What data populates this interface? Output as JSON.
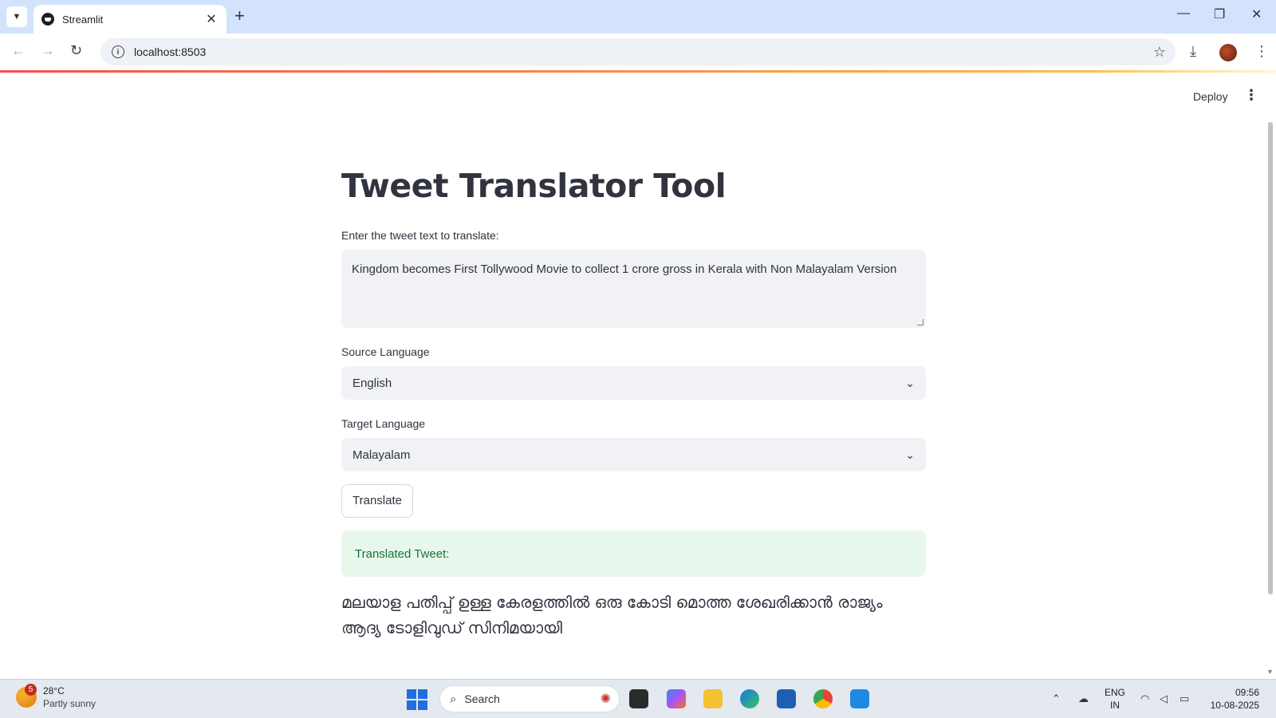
{
  "browser": {
    "tab_title": "Streamlit",
    "url": "localhost:8503"
  },
  "app": {
    "deploy_label": "Deploy",
    "title": "Tweet Translator Tool",
    "input_label": "Enter the tweet text to translate:",
    "input_value": "Kingdom becomes First Tollywood Movie to collect 1 crore gross in Kerala with Non Malayalam Version",
    "source_label": "Source Language",
    "source_value": "English",
    "target_label": "Target Language",
    "target_value": "Malayalam",
    "translate_button": "Translate",
    "success_text": "Translated Tweet:",
    "result_text": "മലയാള പതിപ്പ് ഉള്ള കേരളത്തിൽ ഒരു കോടി മൊത്ത ശേഖരിക്കാൻ രാജ്യം ആദ്യ ടോളിവുഡ് സിനിമയായി"
  },
  "taskbar": {
    "weather_badge": "5",
    "weather_temp": "28°C",
    "weather_desc": "Partly sunny",
    "search_placeholder": "Search",
    "lang_top": "ENG",
    "lang_bottom": "IN",
    "time": "09:56",
    "date": "10-08-2025"
  },
  "colors": {
    "accent_red": "#ff4b4b",
    "success_bg": "#e8f7ec",
    "success_text": "#177233",
    "input_bg": "#f0f2f6"
  }
}
